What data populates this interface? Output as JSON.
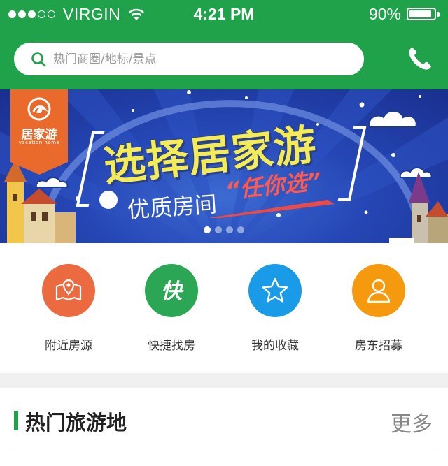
{
  "status_bar": {
    "carrier": "VIRGIN",
    "signal_filled": 3,
    "signal_total": 5,
    "time": "4:21 PM",
    "battery_text": "90%",
    "battery_level": 0.9,
    "wifi_icon": "wifi-icon"
  },
  "header": {
    "search_placeholder": "热门商圈/地标/景点",
    "search_icon": "search-icon",
    "phone_icon": "phone-icon",
    "background_color": "#1fa24a"
  },
  "banner": {
    "logo_name": "居家游",
    "logo_sub": "vacation home",
    "headline": "选择居家游",
    "subheadline": "优质房间",
    "accent": "“任你选”",
    "slide_count": 4,
    "active_slide": 1
  },
  "quick_actions": [
    {
      "label": "附近房源",
      "icon": "map-pin-icon",
      "color": "#ec6a40"
    },
    {
      "label": "快捷找房",
      "icon": "quick-text-icon",
      "glyph": "快",
      "color": "#2aa654"
    },
    {
      "label": "我的收藏",
      "icon": "star-icon",
      "color": "#1a9be8"
    },
    {
      "label": "房东招募",
      "icon": "user-icon",
      "color": "#f59a0f"
    }
  ],
  "hot_section": {
    "title": "热门旅游地",
    "more": "更多"
  }
}
